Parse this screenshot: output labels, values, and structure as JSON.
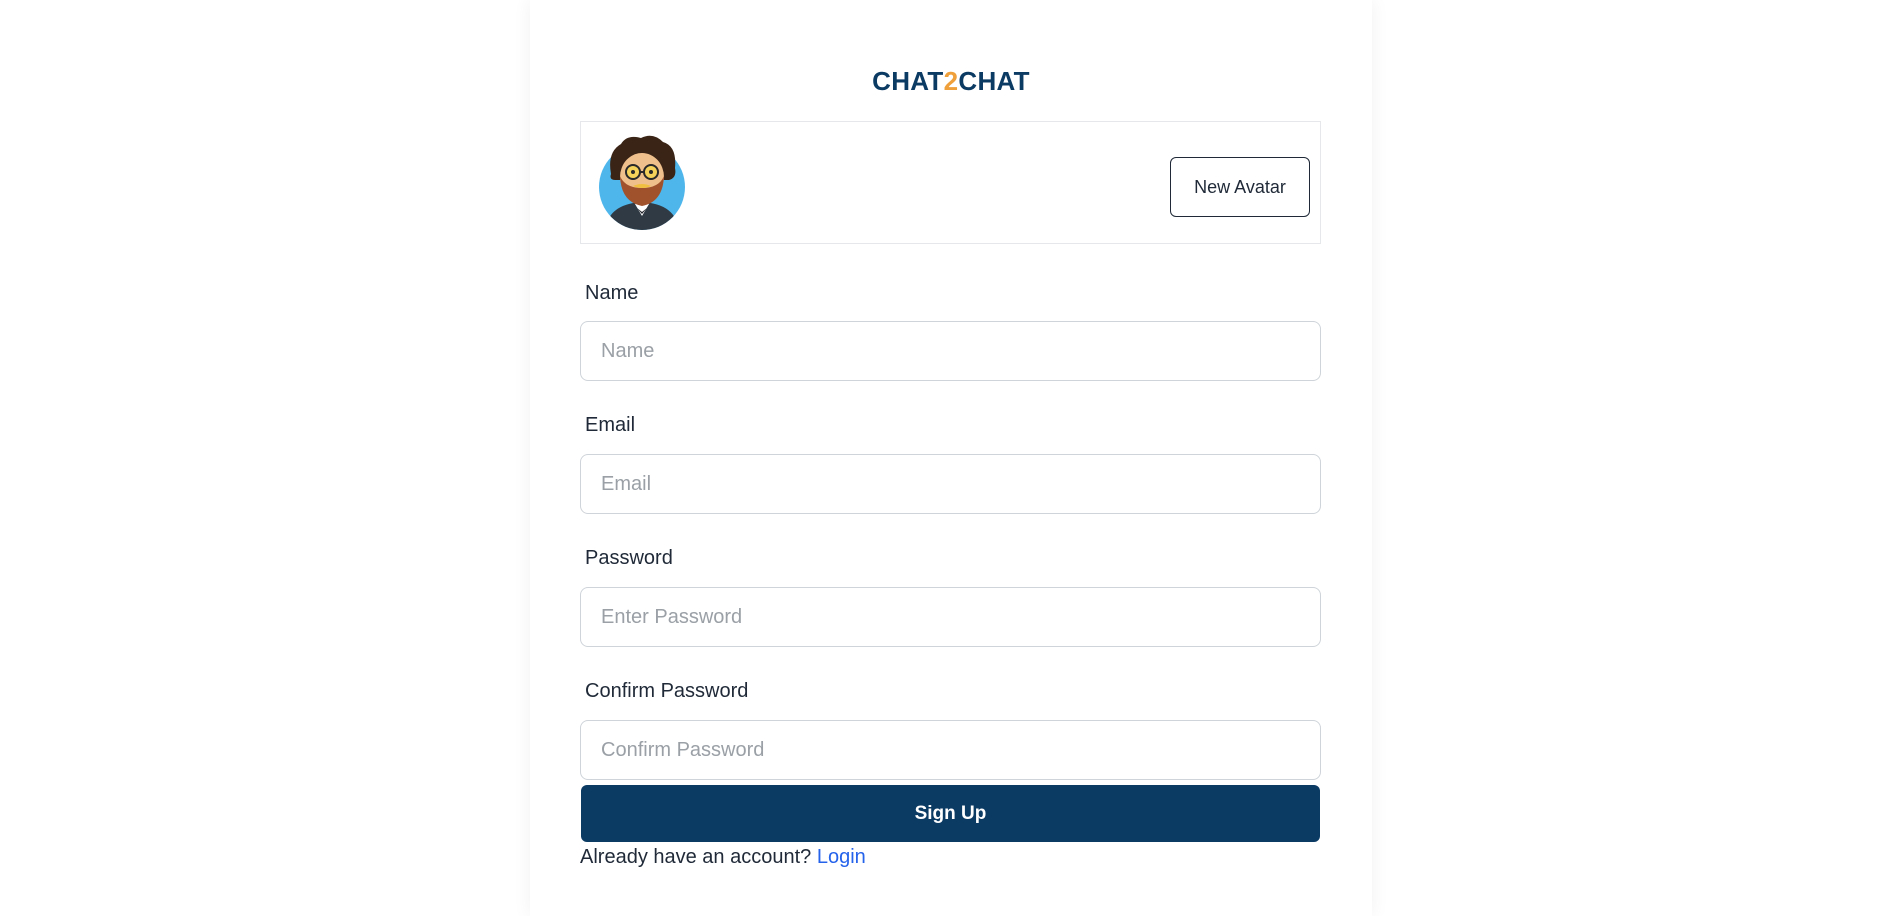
{
  "brand": {
    "part1": "CHAT",
    "part2": "2",
    "part3": "CHAT"
  },
  "avatar": {
    "icon": "avatar-icon",
    "button_label": "New Avatar"
  },
  "form": {
    "name": {
      "label": "Name",
      "placeholder": "Name",
      "value": ""
    },
    "email": {
      "label": "Email",
      "placeholder": "Email",
      "value": ""
    },
    "password": {
      "label": "Password",
      "placeholder": "Enter Password",
      "value": ""
    },
    "confirm_password": {
      "label": "Confirm Password",
      "placeholder": "Confirm Password",
      "value": ""
    },
    "submit_label": "Sign Up"
  },
  "footer": {
    "prompt": "Already have an account?",
    "link_label": "Login"
  },
  "colors": {
    "primary": "#0b3a63",
    "accent": "#f0a03a",
    "link": "#2563eb"
  }
}
